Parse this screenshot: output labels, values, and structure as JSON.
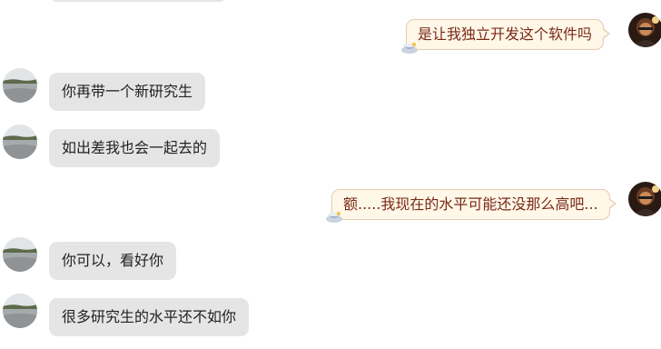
{
  "messages": [
    {
      "side": "right",
      "text": "是让我独立开发这个软件吗"
    },
    {
      "side": "left",
      "text": "你再带一个新研究生"
    },
    {
      "side": "left",
      "text": "如出差我也会一起去的"
    },
    {
      "side": "right",
      "text": "额.....我现在的水平可能还没那么高吧..."
    },
    {
      "side": "left",
      "text": "你可以，看好你"
    },
    {
      "side": "left",
      "text": "很多研究生的水平还不如你"
    }
  ],
  "colors": {
    "incoming_bubble": "#e5e5e5",
    "outgoing_bubble": "#fff7e8",
    "outgoing_border": "#e2ccb0",
    "outgoing_text": "#7a2a17"
  },
  "icons": {
    "self_avatar": "user-avatar-photo",
    "contact_avatar": "landscape-avatar-photo",
    "bubble_decoration": "cup-icon"
  }
}
